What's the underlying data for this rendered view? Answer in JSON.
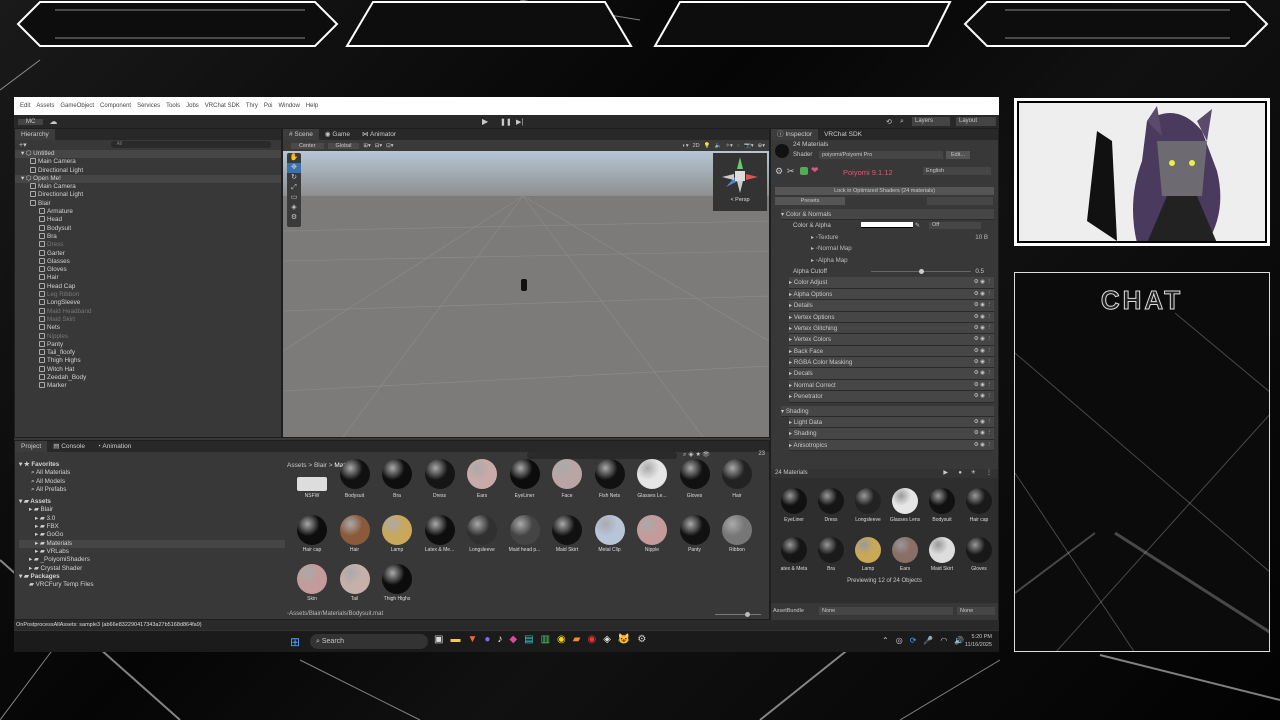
{
  "unity": {
    "menu": [
      "Edit",
      "Assets",
      "GameObject",
      "Component",
      "Services",
      "Tools",
      "Jobs",
      "VRChat SDK",
      "Thry",
      "Poi",
      "Window",
      "Help"
    ],
    "account_label": "MC",
    "layers_label": "Layers",
    "layout_label": "Layout",
    "hierarchy": {
      "tab": "Hierarchy",
      "search_placeholder": "All",
      "items": [
        {
          "label": "Untitled",
          "level": 0,
          "type": "scene"
        },
        {
          "label": "Main Camera",
          "level": 1,
          "type": "obj"
        },
        {
          "label": "Directional Light",
          "level": 1,
          "type": "obj"
        },
        {
          "label": "Open Me!",
          "level": 0,
          "type": "scene"
        },
        {
          "label": "Main Camera",
          "level": 1,
          "type": "obj"
        },
        {
          "label": "Directional Light",
          "level": 1,
          "type": "obj"
        },
        {
          "label": "Blair",
          "level": 1,
          "type": "obj"
        },
        {
          "label": "Armature",
          "level": 2,
          "type": "obj"
        },
        {
          "label": "Head",
          "level": 2,
          "type": "obj"
        },
        {
          "label": "Bodysuit",
          "level": 2,
          "type": "obj"
        },
        {
          "label": "Bra",
          "level": 2,
          "type": "obj"
        },
        {
          "label": "Dress",
          "level": 2,
          "type": "dim"
        },
        {
          "label": "Garter",
          "level": 2,
          "type": "obj"
        },
        {
          "label": "Glasses",
          "level": 2,
          "type": "obj"
        },
        {
          "label": "Gloves",
          "level": 2,
          "type": "obj"
        },
        {
          "label": "Hair",
          "level": 2,
          "type": "obj"
        },
        {
          "label": "Head Cap",
          "level": 2,
          "type": "obj"
        },
        {
          "label": "Leg Ribbon",
          "level": 2,
          "type": "dim"
        },
        {
          "label": "LongSleeve",
          "level": 2,
          "type": "obj"
        },
        {
          "label": "Maid Headband",
          "level": 2,
          "type": "dim"
        },
        {
          "label": "Maid Skirt",
          "level": 2,
          "type": "dim"
        },
        {
          "label": "Nets",
          "level": 2,
          "type": "obj"
        },
        {
          "label": "Nipples",
          "level": 2,
          "type": "dim"
        },
        {
          "label": "Panty",
          "level": 2,
          "type": "obj"
        },
        {
          "label": "Tail_floofy",
          "level": 2,
          "type": "obj"
        },
        {
          "label": "Thigh Highs",
          "level": 2,
          "type": "obj"
        },
        {
          "label": "Witch Hat",
          "level": 2,
          "type": "obj"
        },
        {
          "label": "Zeedah_Body",
          "level": 2,
          "type": "obj"
        },
        {
          "label": "Marker",
          "level": 2,
          "type": "obj"
        }
      ]
    },
    "scene": {
      "tabs": [
        "Scene",
        "Game",
        "Animator"
      ],
      "pivot": "Center",
      "space": "Global",
      "mode_2d": "2D",
      "persp_label": "< Persp"
    },
    "project": {
      "tabs": [
        "Project",
        "Console",
        "Animation"
      ],
      "breadcrumb": [
        "Assets",
        "Blair",
        "Materials"
      ],
      "favorites_label": "Favorites",
      "favorites": [
        "All Materials",
        "All Models",
        "All Prefabs"
      ],
      "assets_label": "Assets",
      "tree": [
        {
          "label": "Blair",
          "level": 1
        },
        {
          "label": "3.0",
          "level": 2
        },
        {
          "label": "FBX",
          "level": 2
        },
        {
          "label": "GoGo",
          "level": 2
        },
        {
          "label": "Materials",
          "level": 2,
          "sel": true
        },
        {
          "label": "VRLabs",
          "level": 2
        },
        {
          "label": "_PoiyomiShaders",
          "level": 1
        },
        {
          "label": "Crystal Shader",
          "level": 1
        }
      ],
      "packages_label": "Packages",
      "packages": [
        "VRCFury Temp Files"
      ],
      "zoom_count": "23",
      "row1_labels": [
        "NSFW",
        "Bodysuit",
        "Bra",
        "Dress",
        "Ears",
        "EyeLiner",
        "Face",
        "Fish Nets",
        "Glasses Le...",
        "Gloves",
        "Hair"
      ],
      "row2_labels": [
        "Hair cap",
        "Hair",
        "Lamp",
        "Latex & Me...",
        "Longsleeve",
        "Maid head p...",
        "Maid Skirt",
        "Metal Clip",
        "Nipple",
        "Panty",
        "Ribbon"
      ],
      "row3_labels": [
        "Skin",
        "Tail",
        "Thigh Highs"
      ],
      "path": "Assets/Blair/Materials/Bodysuit.mat"
    },
    "inspector": {
      "tabs": [
        "Inspector",
        "VRChat SDK"
      ],
      "title": "24 Materials",
      "shader_label": "Shader",
      "shader_value": "poiyomi/Poiyomi Pro",
      "edit_label": "Edit...",
      "version": "Poiyomi 9.1.12",
      "language": "English",
      "lock_button": "Lock in Optimized Shaders (24 materials)",
      "presets_label": "Presets",
      "color_normals": "Color & Normals",
      "color_alpha": "Color & Alpha",
      "off_label": "Off",
      "texture": "Texture",
      "texture_value": "10 B",
      "normal_map": "Normal Map",
      "alpha_map": "Alpha Map",
      "alpha_cutoff": "Alpha Cutoff",
      "alpha_cutoff_value": "0.5",
      "alpha_cutoff_fraction": 0.5,
      "sections": [
        "Color Adjust",
        "Alpha Options",
        "Details",
        "Vertex Options",
        "Vertex Glitching",
        "Vertex Colors",
        "Back Face",
        "RGBA Color Masking",
        "Decals",
        "Normal Correct",
        "Penetrator"
      ],
      "shading_header": "Shading",
      "shading_sections": [
        "Light Data",
        "Shading",
        "Anisotropics"
      ],
      "preview_title": "24 Materials",
      "preview_row1": [
        "EyeLiner",
        "Dress",
        "Longsleeve",
        "Glasses Lens",
        "Bodysuit",
        "Hair cap"
      ],
      "preview_row2": [
        "atex & Meta",
        "Bra",
        "Lamp",
        "Ears",
        "Maid Skirt",
        "Gloves"
      ],
      "preview_status": "Previewing 12 of 24 Objects",
      "asset_bundle_label": "AssetBundle",
      "asset_bundle_value": "None",
      "asset_bundle_variant": "None"
    },
    "status_bar": "OnPostprocessAllAssets: sample3 (ab66e832290417343a27b5168d864fa9)"
  },
  "taskbar": {
    "search_placeholder": "Search",
    "time": "5:20 PM",
    "date": "11/16/2025"
  },
  "chat": {
    "title": "CHAT"
  },
  "colors": {
    "unity_bg": "#383838",
    "accent": "#3a72b0",
    "poiyomi_pink": "#e05577"
  }
}
